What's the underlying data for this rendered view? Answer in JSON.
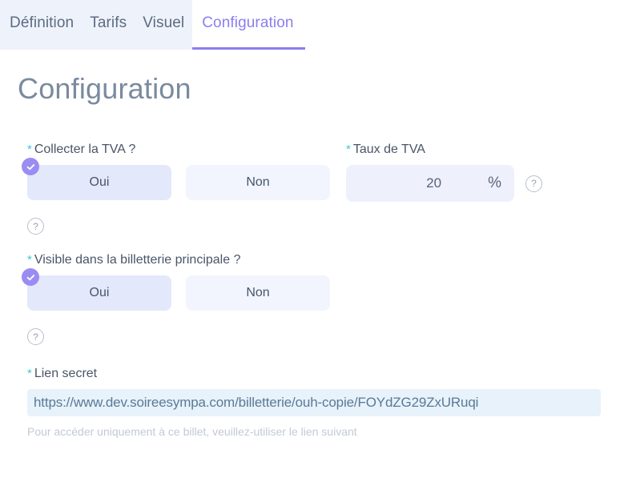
{
  "tabs": [
    {
      "label": "Définition",
      "active": false
    },
    {
      "label": "Tarifs",
      "active": false
    },
    {
      "label": "Visuel",
      "active": false
    },
    {
      "label": "Configuration",
      "active": true
    }
  ],
  "page": {
    "title": "Configuration"
  },
  "colors": {
    "accent_purple": "#8b7ef0",
    "required_asterisk": "#3cc8d8",
    "selected_toggle_bg": "#e3e8fb",
    "toggle_bg": "#f2f5fe",
    "link_field_bg": "#e7f2fb"
  },
  "fields": {
    "collect_vat": {
      "required_mark": "*",
      "label": "Collecter la TVA ?",
      "options": [
        {
          "label": "Oui",
          "selected": true
        },
        {
          "label": "Non",
          "selected": false
        }
      ],
      "help": "?"
    },
    "vat_rate": {
      "required_mark": "*",
      "label": "Taux de TVA",
      "value": "20",
      "suffix": "%",
      "help": "?"
    },
    "visible_main_ticketing": {
      "required_mark": "*",
      "label": "Visible dans la billetterie principale ?",
      "options": [
        {
          "label": "Oui",
          "selected": true
        },
        {
          "label": "Non",
          "selected": false
        }
      ],
      "help": "?"
    },
    "secret_link": {
      "required_mark": "*",
      "label": "Lien secret",
      "value": "https://www.dev.soireesympa.com/billetterie/ouh-copie/FOYdZG29ZxURuqi",
      "hint": "Pour accéder uniquement à ce billet, veuillez-utiliser le lien suivant"
    }
  }
}
